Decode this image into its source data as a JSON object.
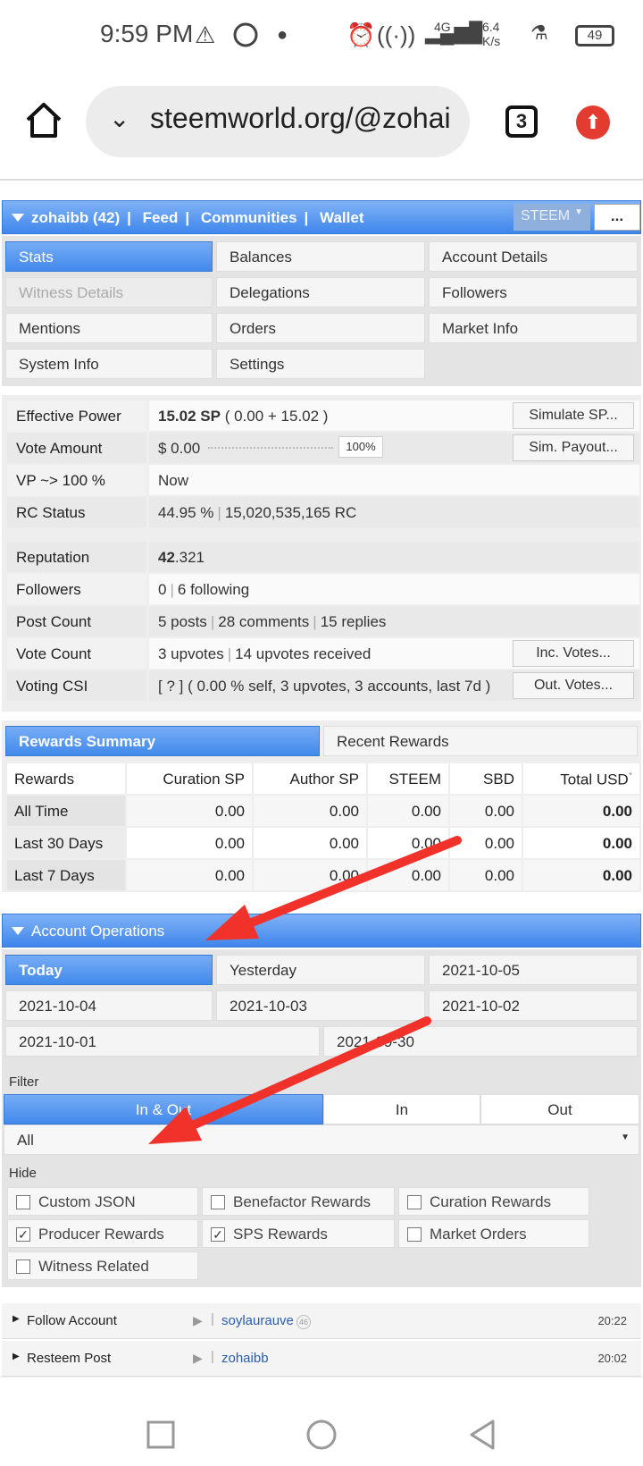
{
  "status_bar": {
    "time": "9:59 PM",
    "net_speed_value": "6.4",
    "net_speed_unit": "K/s",
    "net_type": "4G",
    "battery": "49"
  },
  "browser": {
    "url": "steemworld.org/@zohai",
    "tab_count": "3"
  },
  "top_nav": {
    "user": "zohaibb (42)",
    "feed": "Feed",
    "communities": "Communities",
    "wallet": "Wallet",
    "currency": "STEEM",
    "more": "..."
  },
  "menu": {
    "stats": "Stats",
    "balances": "Balances",
    "account_details": "Account Details",
    "witness_details": "Witness Details",
    "delegations": "Delegations",
    "followers": "Followers",
    "mentions": "Mentions",
    "orders": "Orders",
    "market_info": "Market Info",
    "system_info": "System Info",
    "settings": "Settings"
  },
  "stats": {
    "effective_power_label": "Effective Power",
    "effective_power_sp": "15.02 SP",
    "effective_power_detail": "( 0.00 + 15.02 )",
    "simulate_sp": "Simulate SP...",
    "vote_amount_label": "Vote Amount",
    "vote_amount_value": "$ 0.00",
    "vote_percent": "100%",
    "sim_payout": "Sim. Payout...",
    "vp_label": "VP ~> 100 %",
    "vp_value": "Now",
    "rc_label": "RC Status",
    "rc_percent": "44.95 %",
    "rc_value": "15,020,535,165 RC",
    "reputation_label": "Reputation",
    "reputation_int": "42",
    "reputation_dec": ".321",
    "followers_label": "Followers",
    "followers_count": "0",
    "following": "6 following",
    "post_count_label": "Post Count",
    "posts": "5 posts",
    "comments": "28 comments",
    "replies": "15 replies",
    "vote_count_label": "Vote Count",
    "upvotes": "3 upvotes",
    "upvotes_received": "14 upvotes received",
    "inc_votes": "Inc. Votes...",
    "voting_csi_label": "Voting CSI",
    "voting_csi_value": "[ ? ] ( 0.00 % self, 3 upvotes, 3 accounts, last 7d )",
    "out_votes": "Out. Votes..."
  },
  "rewards": {
    "tab_summary": "Rewards Summary",
    "tab_recent": "Recent Rewards",
    "headers": [
      "Rewards",
      "Curation SP",
      "Author SP",
      "STEEM",
      "SBD",
      "Total USD"
    ],
    "rows": [
      {
        "label": "All Time",
        "values": [
          "0.00",
          "0.00",
          "0.00",
          "0.00",
          "0.00"
        ]
      },
      {
        "label": "Last 30 Days",
        "values": [
          "0.00",
          "0.00",
          "0.00",
          "0.00",
          "0.00"
        ]
      },
      {
        "label": "Last 7 Days",
        "values": [
          "0.00",
          "0.00",
          "0.00",
          "0.00",
          "0.00"
        ]
      }
    ]
  },
  "account_ops": {
    "title": "Account Operations",
    "days": [
      "Today",
      "Yesterday",
      "2021-10-05",
      "2021-10-04",
      "2021-10-03",
      "2021-10-02",
      "2021-10-01",
      "2021-09-30"
    ],
    "filter_label": "Filter",
    "filter_inout": "In & Out",
    "filter_in": "In",
    "filter_out": "Out",
    "select_value": "All",
    "hide_label": "Hide",
    "hide_options": [
      {
        "label": "Custom JSON",
        "checked": false
      },
      {
        "label": "Benefactor Rewards",
        "checked": false
      },
      {
        "label": "Curation Rewards",
        "checked": false
      },
      {
        "label": "Producer Rewards",
        "checked": true
      },
      {
        "label": "SPS Rewards",
        "checked": true
      },
      {
        "label": "Market Orders",
        "checked": false
      },
      {
        "label": "Witness Related",
        "checked": false
      }
    ],
    "operations": [
      {
        "type": "Follow Account",
        "account": "soylaurauve",
        "rep": "46",
        "time": "20:22"
      },
      {
        "type": "Resteem Post",
        "account": "zohaibb",
        "rep": "",
        "time": "20:02"
      }
    ]
  }
}
